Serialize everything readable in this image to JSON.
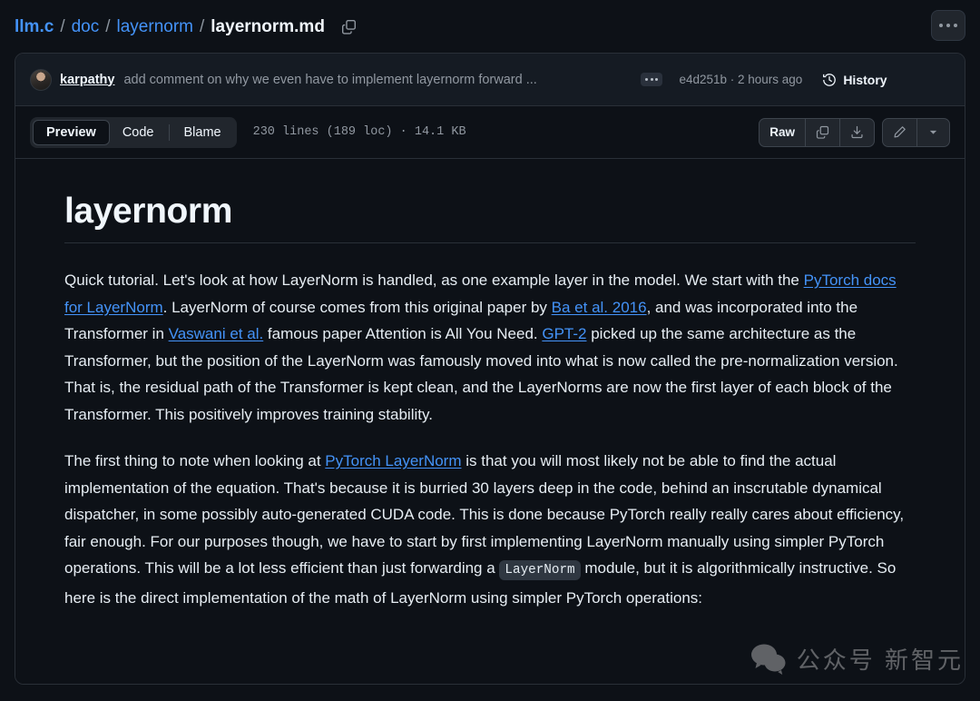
{
  "breadcrumb": {
    "repo": "llm.c",
    "sep": "/",
    "path_1": "doc",
    "path_2": "layernorm",
    "filename": "layernorm.md",
    "copy_icon": "copy-icon",
    "kebab_icon": "kebab-menu-icon"
  },
  "commit": {
    "avatar_alt": "karpathy-avatar",
    "author": "karpathy",
    "message": "add comment on why we even have to implement layernorm forward ...",
    "expand_icon": "ellipsis-expand-icon",
    "hash": "e4d251b",
    "separator": "·",
    "time": "2 hours ago",
    "meta": "e4d251b · 2 hours ago",
    "history_label": "History",
    "history_icon": "history-clock-icon"
  },
  "toolbar": {
    "tabs": [
      {
        "label": "Preview",
        "active": true
      },
      {
        "label": "Code",
        "active": false
      },
      {
        "label": "Blame",
        "active": false
      }
    ],
    "stats": "230 lines (189 loc) · 14.1 KB",
    "lines": "230 lines",
    "loc": "(189 loc)",
    "size": "14.1 KB",
    "raw_label": "Raw",
    "copy_icon": "copy-icon",
    "download_icon": "download-icon",
    "edit_icon": "pencil-edit-icon",
    "dropdown_icon": "chevron-down-icon"
  },
  "document": {
    "title": "layernorm",
    "paragraph_1": {
      "part_1": "Quick tutorial. Let's look at how LayerNorm is handled, as one example layer in the model. We start with the ",
      "link_1": "PyTorch docs for LayerNorm",
      "part_2": ". LayerNorm of course comes from this original paper by ",
      "link_2": "Ba et al. 2016",
      "part_3": ", and was incorporated into the Transformer in ",
      "link_3": "Vaswani et al.",
      "part_4": " famous paper Attention is All You Need. ",
      "link_4": "GPT-2",
      "part_5": " picked up the same architecture as the Transformer, but the position of the LayerNorm was famously moved into what is now called the pre-normalization version. That is, the residual path of the Transformer is kept clean, and the LayerNorms are now the first layer of each block of the Transformer. This positively improves training stability."
    },
    "paragraph_2": {
      "part_1": "The first thing to note when looking at ",
      "link_1": "PyTorch LayerNorm",
      "part_2": " is that you will most likely not be able to find the actual implementation of the equation. That's because it is burried 30 layers deep in the code, behind an inscrutable dynamical dispatcher, in some possibly auto-generated CUDA code. This is done because PyTorch really really cares about efficiency, fair enough. For our purposes though, we have to start by first implementing LayerNorm manually using simpler PyTorch operations. This will be a lot less efficient than just forwarding a ",
      "code_1": "LayerNorm",
      "part_3": " module, but it is algorithmically instructive. So here is the direct implementation of the math of LayerNorm using simpler PyTorch operations:"
    }
  },
  "watermark": {
    "icon": "wechat-bubble-icon",
    "text": "公众号   新智元"
  },
  "colors": {
    "page_bg": "#0d1117",
    "panel_header_bg": "#151b23",
    "border": "#2a3038",
    "link": "#4493f8",
    "text": "#e6edf3",
    "muted": "#9198a1"
  }
}
